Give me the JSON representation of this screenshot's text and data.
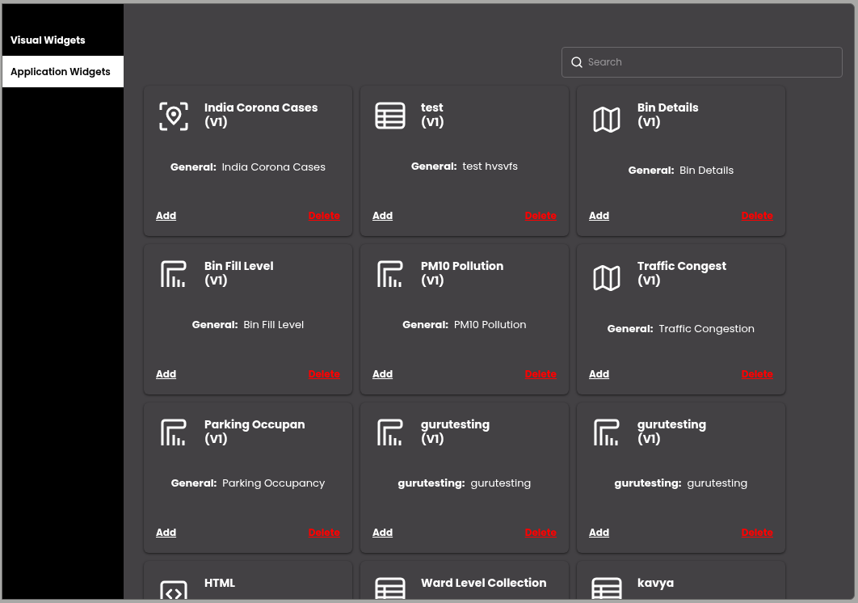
{
  "sidebar": {
    "items": [
      {
        "label": "Visual Widgets",
        "selected": false
      },
      {
        "label": "Application Widgets",
        "selected": true
      }
    ]
  },
  "search": {
    "placeholder": "Search"
  },
  "widgets": [
    {
      "kind": "location",
      "title": "India Corona Cases",
      "version": "(V1)",
      "label": "General:",
      "value": "India Corona Cases",
      "add": "Add",
      "delete": "Delete"
    },
    {
      "kind": "table",
      "title": "test",
      "version": "(V1)",
      "label": "General:",
      "value": "test hvsvfs",
      "add": "Add",
      "delete": "Delete"
    },
    {
      "kind": "map",
      "title": "Bin Details",
      "version": "(V1)",
      "label": "General:",
      "value": "Bin Details",
      "add": "Add",
      "delete": "Delete"
    },
    {
      "kind": "chart",
      "title": "Bin Fill Level",
      "version": "(V1)",
      "label": "General:",
      "value": "Bin Fill Level",
      "add": "Add",
      "delete": "Delete"
    },
    {
      "kind": "chart",
      "title": "PM10 Pollution",
      "version": "(V1)",
      "label": "General:",
      "value": "PM10 Pollution",
      "add": "Add",
      "delete": "Delete"
    },
    {
      "kind": "map",
      "title": "Traffic Congest",
      "version": "(V1)",
      "label": "General:",
      "value": "Traffic Congestion",
      "add": "Add",
      "delete": "Delete"
    },
    {
      "kind": "chart",
      "title": "Parking Occupan",
      "version": "(V1)",
      "label": "General:",
      "value": "Parking Occupancy",
      "add": "Add",
      "delete": "Delete"
    },
    {
      "kind": "chart",
      "title": "gurutesting",
      "version": "(V1)",
      "label": "gurutesting:",
      "value": "gurutesting",
      "add": "Add",
      "delete": "Delete"
    },
    {
      "kind": "chart",
      "title": "gurutesting",
      "version": "(V1)",
      "label": "gurutesting:",
      "value": "gurutesting",
      "add": "Add",
      "delete": "Delete"
    },
    {
      "kind": "code",
      "title": "HTML"
    },
    {
      "kind": "table",
      "title": "Ward Level Collection"
    },
    {
      "kind": "table",
      "title": "kavya"
    }
  ]
}
